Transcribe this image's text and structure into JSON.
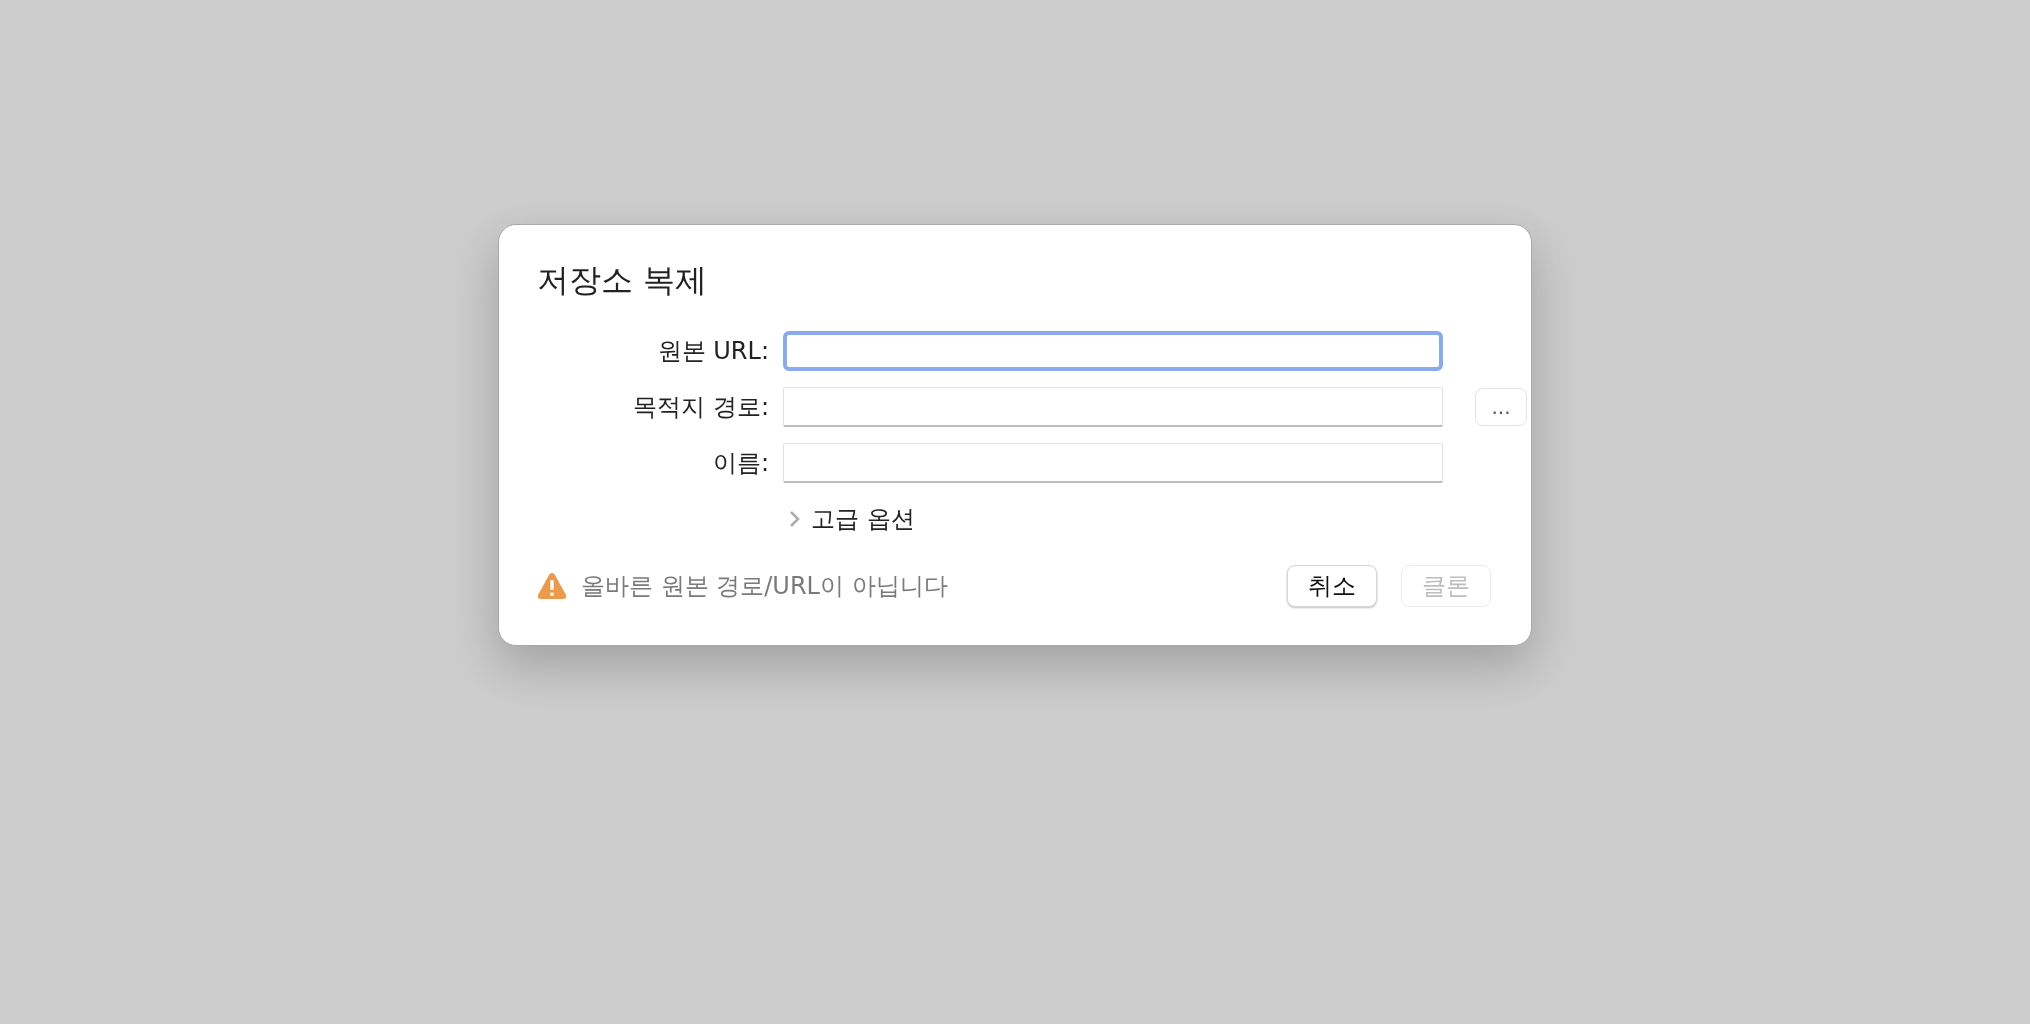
{
  "dialog": {
    "title": "저장소 복제",
    "fields": [
      {
        "label": "원본 URL:",
        "focused": true
      },
      {
        "label": "목적지 경로:",
        "focused": false,
        "browse": "..."
      },
      {
        "label": "이름:",
        "focused": false
      }
    ],
    "advanced": {
      "label": "고급 옵션",
      "expanded": false
    },
    "warning": "올바른 원본 경로/URL이 아닙니다",
    "buttons": [
      {
        "label": "취소",
        "disabled": false
      },
      {
        "label": "클론",
        "disabled": true
      }
    ]
  }
}
